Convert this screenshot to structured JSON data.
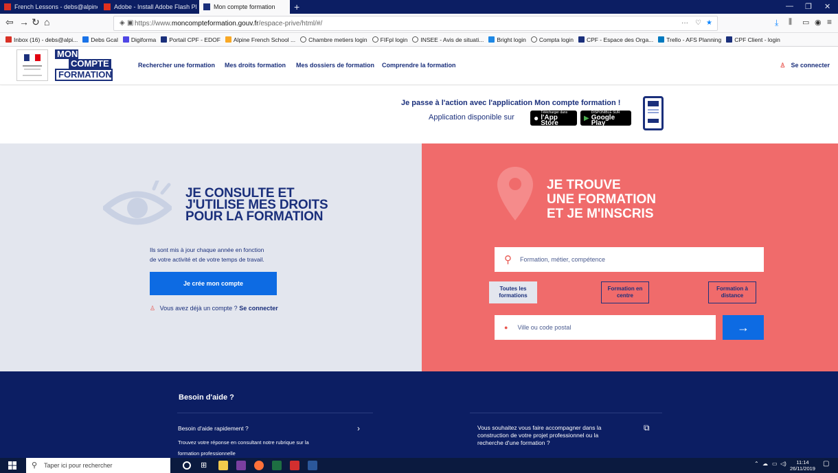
{
  "browser": {
    "tabs": [
      {
        "title": "French Lessons - debs@alpine",
        "active": false
      },
      {
        "title": "Adobe - Install Adobe Flash Pl",
        "active": false
      },
      {
        "title": "Mon compte formation",
        "active": true
      }
    ],
    "url_prefix": "https://www.",
    "url_domain": "moncompteformation.gouv.fr",
    "url_path": "/espace-prive/html/#/",
    "url_menu": "···"
  },
  "bookmarks": [
    {
      "label": "Inbox (16) - debs@alpi...",
      "color": "#d93025"
    },
    {
      "label": "Debs Gcal",
      "color": "#1a73e8"
    },
    {
      "label": "Digiforma",
      "color": "#4f46e5"
    },
    {
      "label": "Portail CPF - EDOF",
      "color": "#1a2f7b"
    },
    {
      "label": "Alpine French School ...",
      "color": "#f9a825"
    },
    {
      "label": "Chambre metiers login",
      "color": "#555555"
    },
    {
      "label": "FIFpl login",
      "color": "#555555"
    },
    {
      "label": "INSEE - Avis de situati...",
      "color": "#555555"
    },
    {
      "label": "Bright login",
      "color": "#1e88e5"
    },
    {
      "label": "Compta login",
      "color": "#555555"
    },
    {
      "label": "CPF - Espace des Orga...",
      "color": "#1a2f7b"
    },
    {
      "label": "Trello - AFS Planning",
      "color": "#0079bf"
    },
    {
      "label": "CPF Client - login",
      "color": "#1a2f7b"
    }
  ],
  "header": {
    "logo_lines": [
      "MON",
      "COMPTE",
      "FORMATION"
    ],
    "nav": [
      "Rechercher une formation",
      "Mes droits formation",
      "Mes dossiers de formation",
      "Comprendre la formation"
    ],
    "connect": "Se connecter"
  },
  "promo": {
    "title": "Je passe à l'action avec l'application Mon compte formation !",
    "subtitle": "Application disponible sur",
    "appstore_small": "Télécharger dans",
    "appstore_big": "l'App Store",
    "googleplay_small": "DISPONIBLE SUR",
    "googleplay_big": "Google Play"
  },
  "left": {
    "title_lines": [
      "JE CONSULTE ET",
      "J'UTILISE MES DROITS",
      "POUR LA FORMATION"
    ],
    "desc_lines": [
      "Ils sont mis à jour chaque année en fonction",
      "de votre activité et de votre temps de travail."
    ],
    "create_button": "Je crée mon compte",
    "has_account": "Vous avez déjà un compte ?",
    "connect_link": "Se connecter"
  },
  "right": {
    "title_lines": [
      "JE TROUVE",
      "UNE FORMATION",
      "ET JE M'INSCRIS"
    ],
    "search_placeholder": "Formation, métier, compétence",
    "filters": [
      {
        "line1": "Toutes les",
        "line2": "formations",
        "selected": true
      },
      {
        "line1": "Formation en",
        "line2": "centre",
        "selected": false
      },
      {
        "line1": "Formation à",
        "line2": "distance",
        "selected": false
      }
    ],
    "location_placeholder": "Ville ou code postal"
  },
  "help": {
    "title": "Besoin d'aide ?",
    "q1": "Besoin d'aide rapidement ?",
    "a1_lines": [
      "Trouvez votre réponse en consultant notre rubrique sur la",
      "formation professionnelle"
    ],
    "q2_lines": [
      "Vous souhaitez vous faire accompagner dans la",
      "construction de votre projet professionnel ou la",
      "recherche d'une formation ?"
    ]
  },
  "taskbar": {
    "search_placeholder": "Taper ici pour rechercher",
    "time": "11:14",
    "date": "26/11/2019"
  },
  "colors": {
    "brand_blue": "#1a2f7b",
    "coral": "#f06b6b",
    "action_blue": "#0d6be3",
    "panel_grey": "#e3e6ee"
  }
}
